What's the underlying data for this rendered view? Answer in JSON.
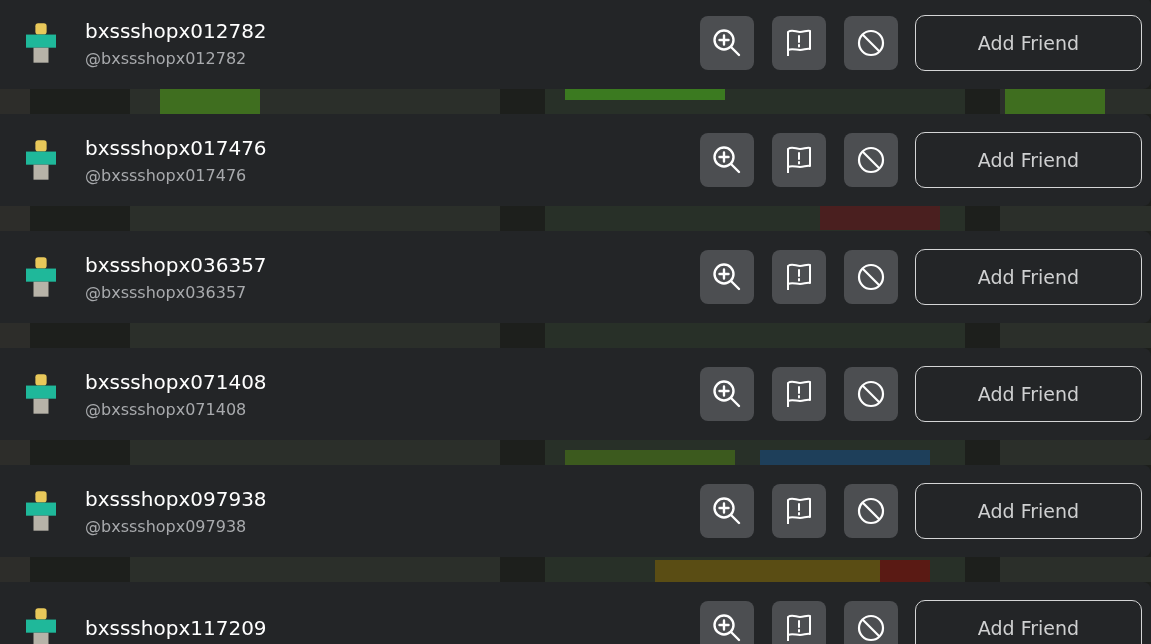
{
  "players": [
    {
      "display_name": "bxssshopx012782",
      "username": "@bxssshopx012782",
      "action": "Add Friend"
    },
    {
      "display_name": "bxssshopx017476",
      "username": "@bxssshopx017476",
      "action": "Add Friend"
    },
    {
      "display_name": "bxssshopx036357",
      "username": "@bxssshopx036357",
      "action": "Add Friend"
    },
    {
      "display_name": "bxssshopx071408",
      "username": "@bxssshopx071408",
      "action": "Add Friend"
    },
    {
      "display_name": "bxssshopx097938",
      "username": "@bxssshopx097938",
      "action": "Add Friend"
    },
    {
      "display_name": "bxssshopx117209",
      "action": "Add Friend"
    }
  ]
}
